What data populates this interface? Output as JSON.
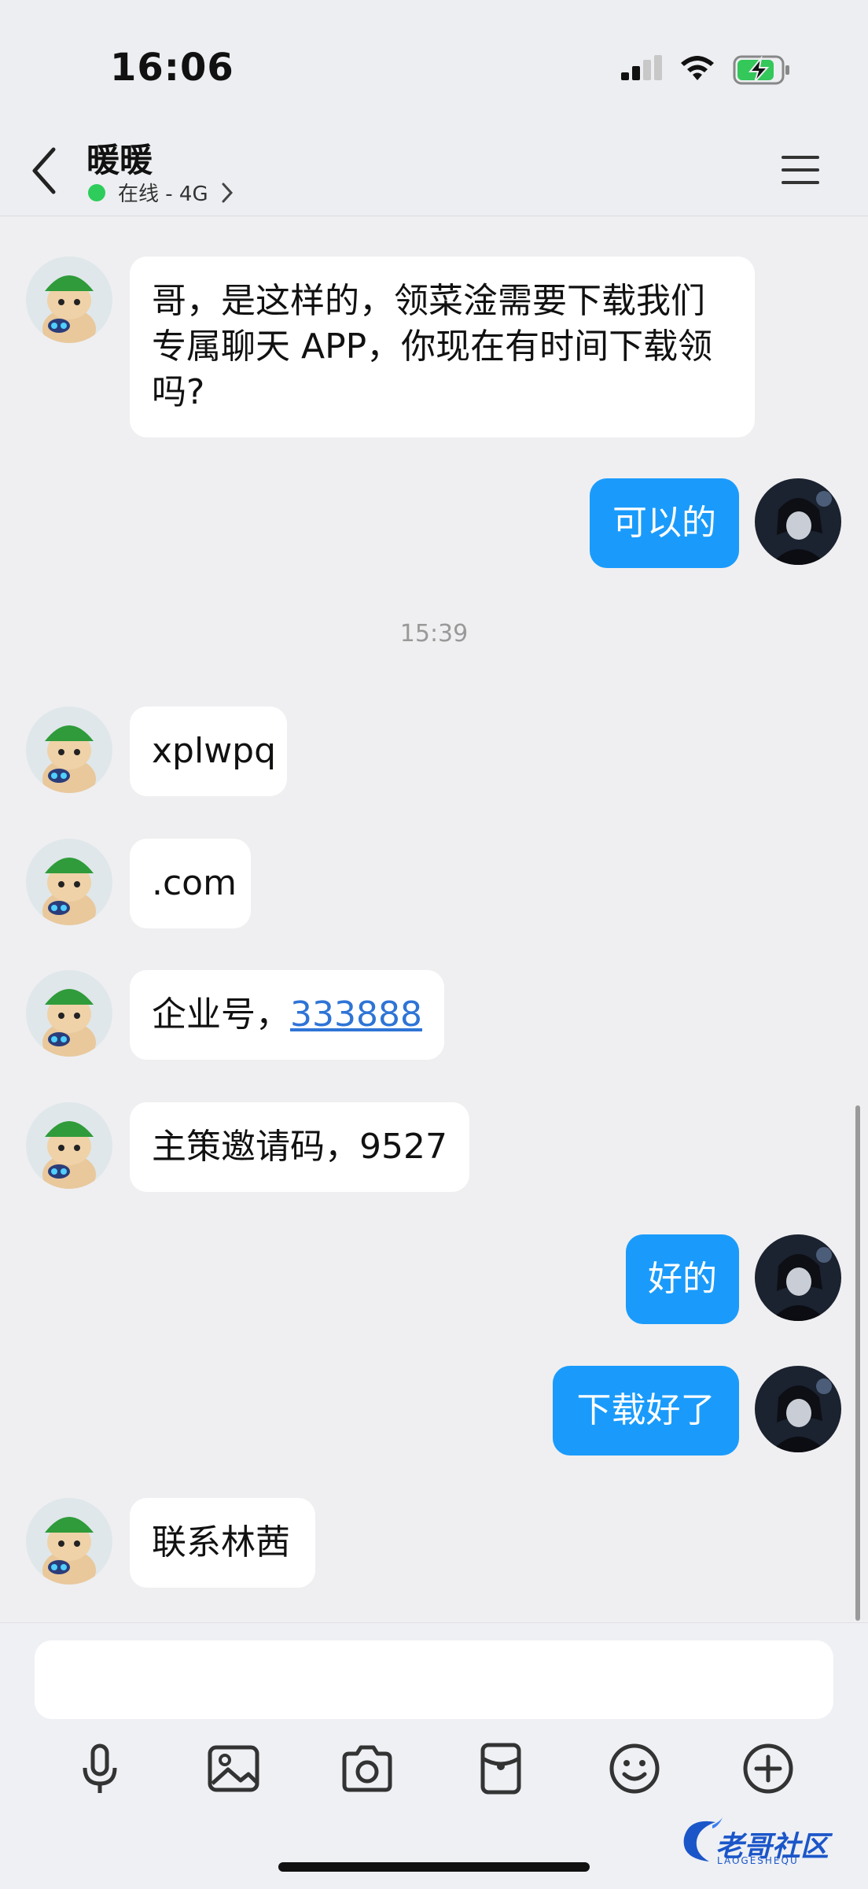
{
  "status_bar": {
    "time": "16:06"
  },
  "header": {
    "title": "暖暖",
    "status": "在线 - 4G"
  },
  "messages": [
    {
      "from": "contact",
      "text": "哥，是这样的，领菜淦需要下载我们专属聊天 APP，你现在有时间下载领吗?"
    },
    {
      "from": "me",
      "text": "可以的"
    },
    {
      "type": "timestamp",
      "text": "15:39"
    },
    {
      "from": "contact",
      "text": "xplwpq"
    },
    {
      "from": "contact",
      "text": ".com"
    },
    {
      "from": "contact",
      "prefix": "企业号，",
      "link": "333888"
    },
    {
      "from": "contact",
      "text": "主策邀请码，9527"
    },
    {
      "from": "me",
      "text": "好的"
    },
    {
      "from": "me",
      "text": "下载好了"
    },
    {
      "from": "contact",
      "text": "联系林茜"
    }
  ],
  "composer": {
    "placeholder": ""
  },
  "toolbar": [
    "microphone-icon",
    "image-icon",
    "camera-icon",
    "red-packet-icon",
    "emoji-icon",
    "plus-icon"
  ],
  "watermark": {
    "text": "老哥社区",
    "sub": "LAOGESHEQU"
  },
  "colors": {
    "outgoing_bubble": "#1a9bfb",
    "incoming_bubble": "#ffffff",
    "online_dot": "#2ecc5a",
    "link": "#2e74d6"
  }
}
